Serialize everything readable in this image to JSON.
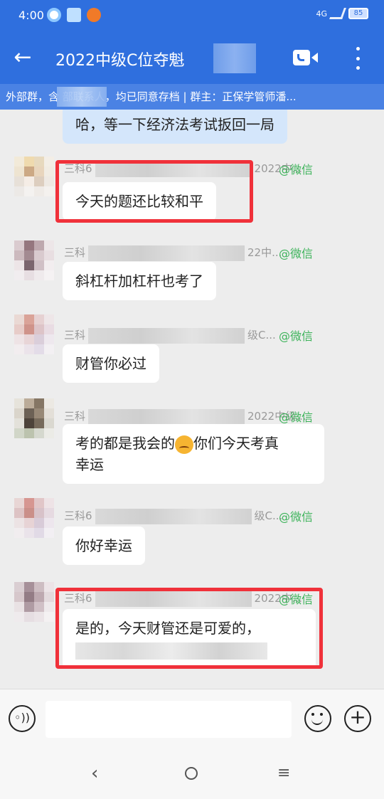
{
  "status": {
    "time": "4:00",
    "network": "4G",
    "battery": "85",
    "icons": [
      "app-notification-icon",
      "gallery-icon",
      "orange-app-icon",
      "signal-icon",
      "battery-icon"
    ]
  },
  "header": {
    "back_icon": "arrow-left-icon",
    "title": "2022中级C位夺魁",
    "video_icon": "video-call-icon",
    "more_icon": "more-vertical-icon"
  },
  "notice": {
    "text": "外部群，含  部联系人，均已同意存档 | 群主：正保学管师潘..."
  },
  "messages": [
    {
      "sender_prefix": "",
      "sender_suffix": "",
      "tag": "",
      "text": "哈，等一下经济法考试扳回一局",
      "variant": "blue"
    },
    {
      "sender_prefix": "三科6",
      "sender_suffix": "2022中...",
      "tag": "@微信",
      "text": "今天的题还比较和平",
      "highlighted": true
    },
    {
      "sender_prefix": "三科",
      "sender_suffix": "22中...",
      "tag": "@微信",
      "text": "斜杠杆加杠杆也考了"
    },
    {
      "sender_prefix": "三科",
      "sender_suffix": "级C...",
      "tag": "@微信",
      "text": "财管你必过"
    },
    {
      "sender_prefix": "三科",
      "sender_suffix": "2022中级...",
      "tag": "@微信",
      "text_before_emoji": "考的都是我会的",
      "text_after_emoji": "你们今天考真",
      "text_line2": "幸运"
    },
    {
      "sender_prefix": "三科6",
      "sender_suffix": "级C...",
      "tag": "@微信",
      "text": "你好幸运"
    },
    {
      "sender_prefix": "三科6",
      "sender_suffix": "2022中...",
      "tag": "@微信",
      "text": "是的，今天财管还是可爱的，",
      "highlighted": true
    }
  ],
  "input": {
    "voice_icon": "voice-input-icon",
    "emoji_icon": "emoji-icon",
    "plus_icon": "plus-icon",
    "placeholder": ""
  },
  "nav": {
    "back": "‹",
    "home": "○",
    "menu": "≡"
  }
}
